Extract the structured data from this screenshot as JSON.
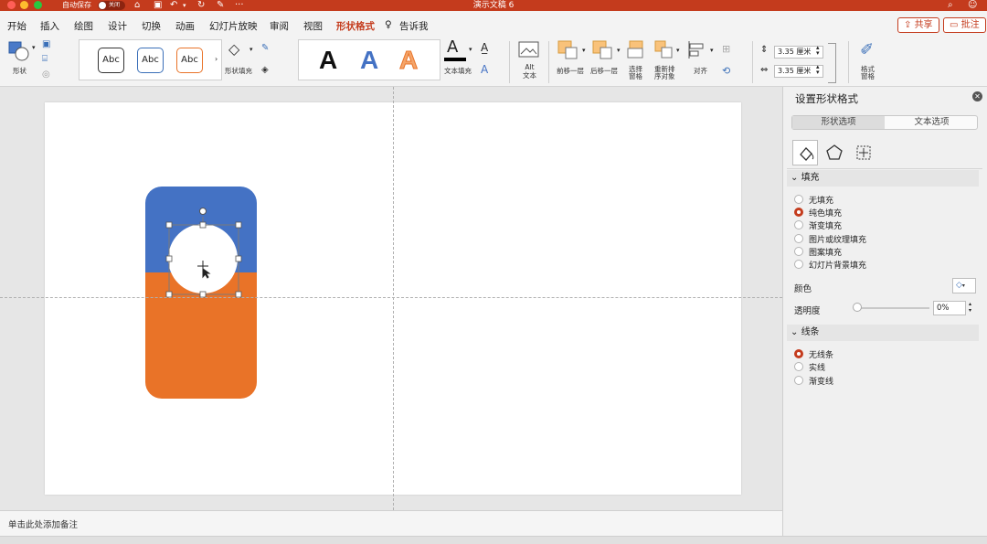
{
  "app": {
    "doc_title": "演示文稿 6",
    "autosave_label": "自动保存",
    "autosave_state": "关闭"
  },
  "menu": {
    "tabs": [
      "开始",
      "插入",
      "绘图",
      "设计",
      "切换",
      "动画",
      "幻灯片放映",
      "审阅",
      "视图",
      "形状格式"
    ],
    "tell_me": "告诉我",
    "share_label": "共享",
    "comment_label": "批注"
  },
  "ribbon": {
    "shape_label": "形状",
    "abc_samples": [
      "Abc",
      "Abc",
      "Abc"
    ],
    "shape_fill_label": "形状填充",
    "wordart_letters": [
      "A",
      "A",
      "A"
    ],
    "text_fill_label": "文本填充",
    "alt_text_label": [
      "Alt",
      "文本"
    ],
    "bring_forward_label": "前移一层",
    "send_backward_label": "后移一层",
    "selection_pane_label": [
      "选择",
      "窗格"
    ],
    "reorder_label": [
      "重新排",
      "序对象"
    ],
    "align_label": "对齐",
    "height_value": "3.35 厘米",
    "width_value": "3.35 厘米",
    "format_pane_label": [
      "格式",
      "窗格"
    ]
  },
  "colors": {
    "accent": "#c43b1d",
    "shape_blue": "#4472c4",
    "shape_orange": "#e97328"
  },
  "notes": {
    "placeholder": "单击此处添加备注"
  },
  "pane": {
    "title": "设置形状格式",
    "tabs": [
      "形状选项",
      "文本选项"
    ],
    "fill_section": "填充",
    "fill_options": [
      "无填充",
      "纯色填充",
      "渐变填充",
      "图片或纹理填充",
      "图案填充",
      "幻灯片背景填充"
    ],
    "fill_selected_index": 1,
    "color_label": "颜色",
    "transparency_label": "透明度",
    "transparency_value": "0%",
    "line_section": "线条",
    "line_options": [
      "无线条",
      "实线",
      "渐变线"
    ],
    "line_selected_index": 0
  }
}
